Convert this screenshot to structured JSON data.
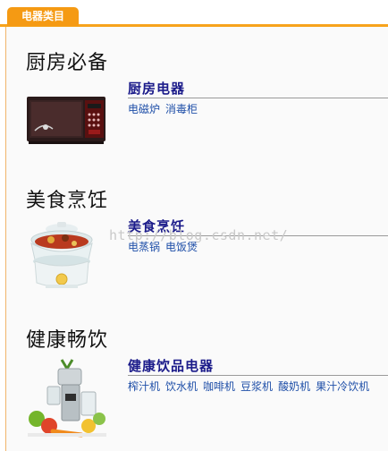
{
  "tab": {
    "label": "电器类目"
  },
  "sections": [
    {
      "heading": "厨房必备",
      "category": "厨房电器",
      "links": [
        "电磁炉",
        "消毒柜"
      ],
      "image": "microwave-oven"
    },
    {
      "heading": "美食烹饪",
      "category": "美食烹饪",
      "links": [
        "电蒸锅",
        "电饭煲"
      ],
      "image": "electric-steamer"
    },
    {
      "heading": "健康畅饮",
      "category": "健康饮品电器",
      "links": [
        "榨汁机",
        "饮水机",
        "咖啡机",
        "豆浆机",
        "酸奶机",
        "果汁冷饮机"
      ],
      "image": "juicer-with-fruit"
    }
  ],
  "watermark": "http://blog.csdn.net/",
  "colors": {
    "tab": "#f59a13",
    "category_title": "#1b1b8a",
    "link": "#1f4fa8"
  }
}
